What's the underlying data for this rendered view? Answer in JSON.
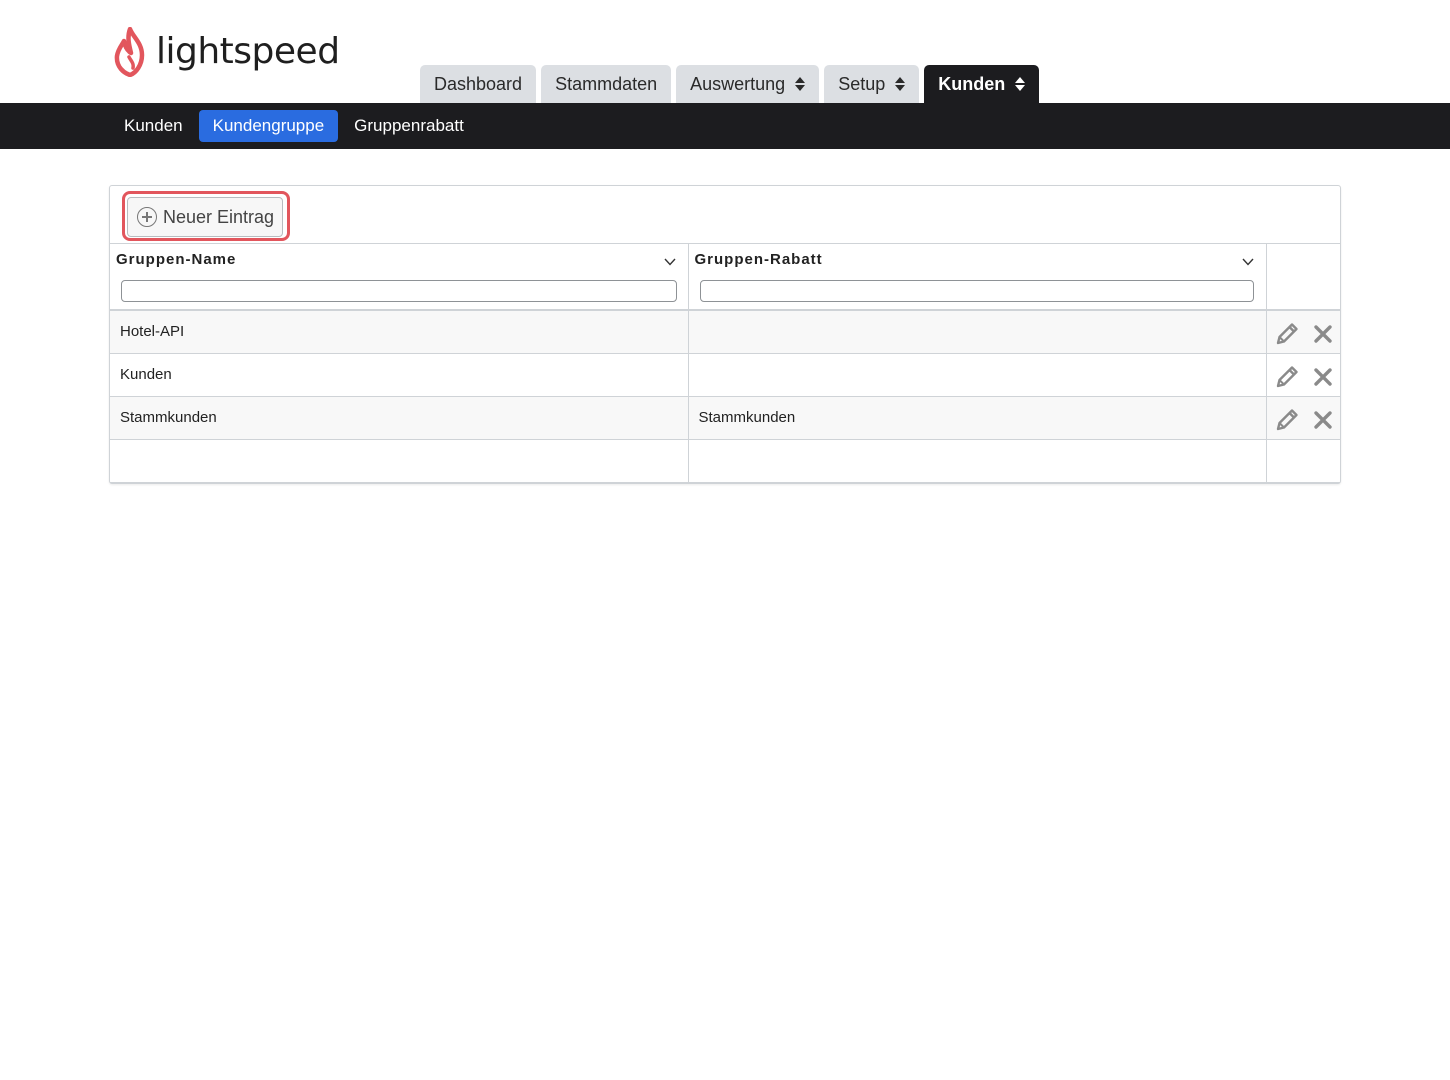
{
  "brand": {
    "name": "lightspeed",
    "logo_color": "#e2565d"
  },
  "main_tabs": [
    {
      "label": "Dashboard",
      "active": false,
      "has_dropdown": false
    },
    {
      "label": "Stammdaten",
      "active": false,
      "has_dropdown": false
    },
    {
      "label": "Auswertung",
      "active": false,
      "has_dropdown": true
    },
    {
      "label": "Setup",
      "active": false,
      "has_dropdown": true
    },
    {
      "label": "Kunden",
      "active": true,
      "has_dropdown": true
    }
  ],
  "subnav": {
    "items": [
      {
        "label": "Kunden",
        "active": false
      },
      {
        "label": "Kundengruppe",
        "active": true
      },
      {
        "label": "Gruppenrabatt",
        "active": false
      }
    ],
    "active_color": "#2a6ce0"
  },
  "toolbar": {
    "new_entry_label": "Neuer Eintrag",
    "highlight_color": "#e2565d"
  },
  "table": {
    "columns": [
      {
        "label": "Gruppen-Name",
        "filter_value": ""
      },
      {
        "label": "Gruppen-Rabatt",
        "filter_value": ""
      }
    ],
    "rows": [
      {
        "name": "Hotel-API",
        "rabatt": ""
      },
      {
        "name": "Kunden",
        "rabatt": ""
      },
      {
        "name": "Stammkunden",
        "rabatt": "Stammkunden"
      }
    ],
    "action_icons": [
      "pencil-icon",
      "close-icon"
    ]
  }
}
